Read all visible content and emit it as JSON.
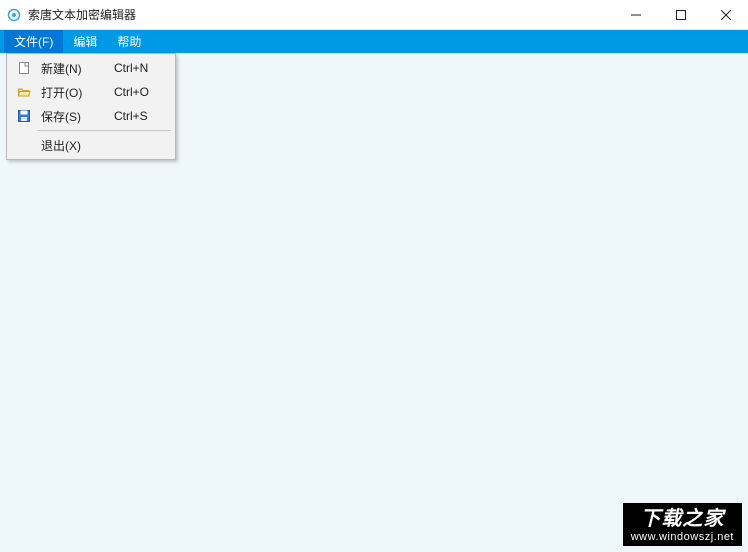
{
  "window": {
    "title": "索唐文本加密编辑器"
  },
  "menubar": {
    "items": [
      {
        "label": "文件(F)",
        "active": true
      },
      {
        "label": "编辑"
      },
      {
        "label": "帮助"
      }
    ]
  },
  "file_menu": {
    "new": {
      "label": "新建(N)",
      "shortcut": "Ctrl+N"
    },
    "open": {
      "label": "打开(O)",
      "shortcut": "Ctrl+O"
    },
    "save": {
      "label": "保存(S)",
      "shortcut": "Ctrl+S"
    },
    "exit": {
      "label": "退出(X)"
    }
  },
  "watermark": {
    "title": "下载之家",
    "url": "www.windowszj.net"
  },
  "colors": {
    "menubar_bg": "#0099e6",
    "menubar_active": "#0078d7",
    "client_bg": "#eef7fb"
  }
}
